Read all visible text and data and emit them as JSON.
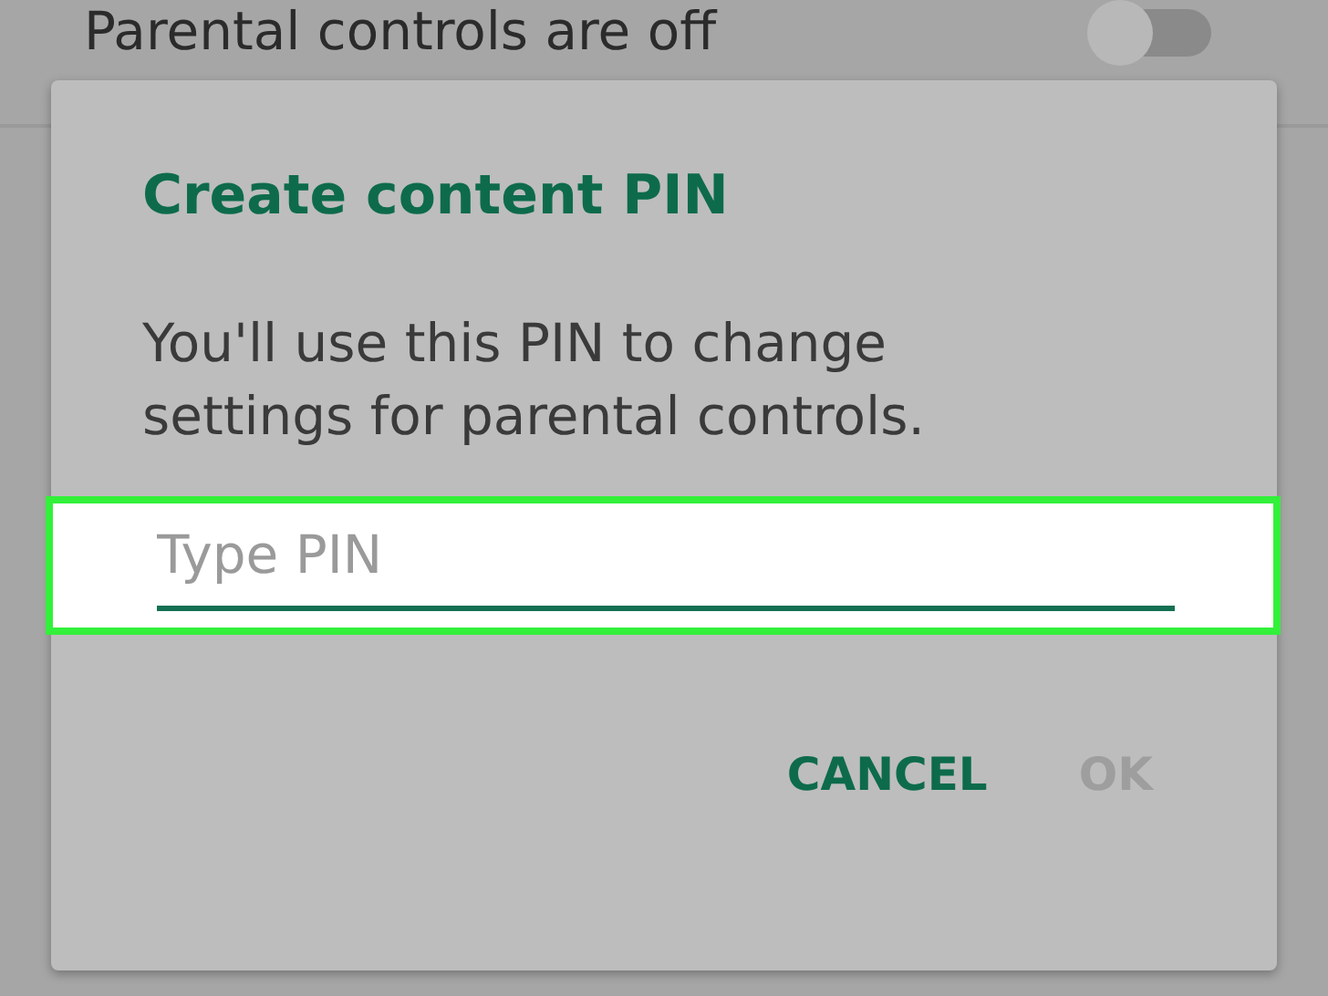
{
  "setting": {
    "label": "Parental controls are off",
    "on": false
  },
  "dialog": {
    "title": "Create content PIN",
    "message": "You'll use this PIN to change settings for parental controls.",
    "pin_field": {
      "placeholder": "Type PIN",
      "highlighted": true
    },
    "buttons": [
      {
        "label": "CANCEL",
        "disabled": false
      },
      {
        "label": "OK",
        "disabled": true
      }
    ]
  }
}
